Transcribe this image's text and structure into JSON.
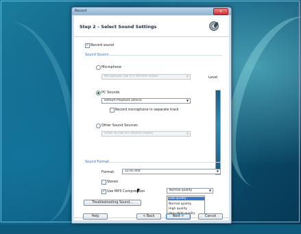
{
  "window": {
    "title": "Record",
    "close_glyph": "✕"
  },
  "header": {
    "step_title": "Step 2 – Select Sound Settings",
    "icon": "gear-microphone-icon"
  },
  "record_sound": {
    "label": "Record sound",
    "checked": true,
    "check_glyph": "✓"
  },
  "sound_source": {
    "group_title": "Sound Source",
    "level_label": "Level",
    "microphone": {
      "label": "Microphone",
      "selected": false,
      "device": "Microphone (SB X-Fi Xtreme Audio)"
    },
    "pc_sounds": {
      "label": "PC Sounds",
      "selected": true,
      "device": "Default Playback Device",
      "separate_track": {
        "label": "Record microphone in separate track",
        "checked": false
      }
    },
    "other_sources": {
      "label": "Other Sound Sources",
      "selected": false,
      "device": "SPDIF-In (SB X-Fi Xtreme Audio)"
    }
  },
  "sound_format": {
    "group_title": "Sound Format",
    "format_label": "Format:",
    "format_value": "22.05 kHz",
    "stereo": {
      "label": "Stereo",
      "checked": false
    },
    "mp3": {
      "label": "Use MP3 Compression",
      "checked": true
    },
    "quality": {
      "value": "Normal quality",
      "options": [
        "Low quality",
        "Normal quality",
        "High quality",
        "Very High quality"
      ],
      "highlighted": "Low quality"
    }
  },
  "troubleshoot_label": "Troubleshooting Sound...",
  "buttons": {
    "help": "Help",
    "back": "< Back",
    "next": "Next >",
    "cancel": "Cancel"
  },
  "dropdown_arrow": "▼"
}
